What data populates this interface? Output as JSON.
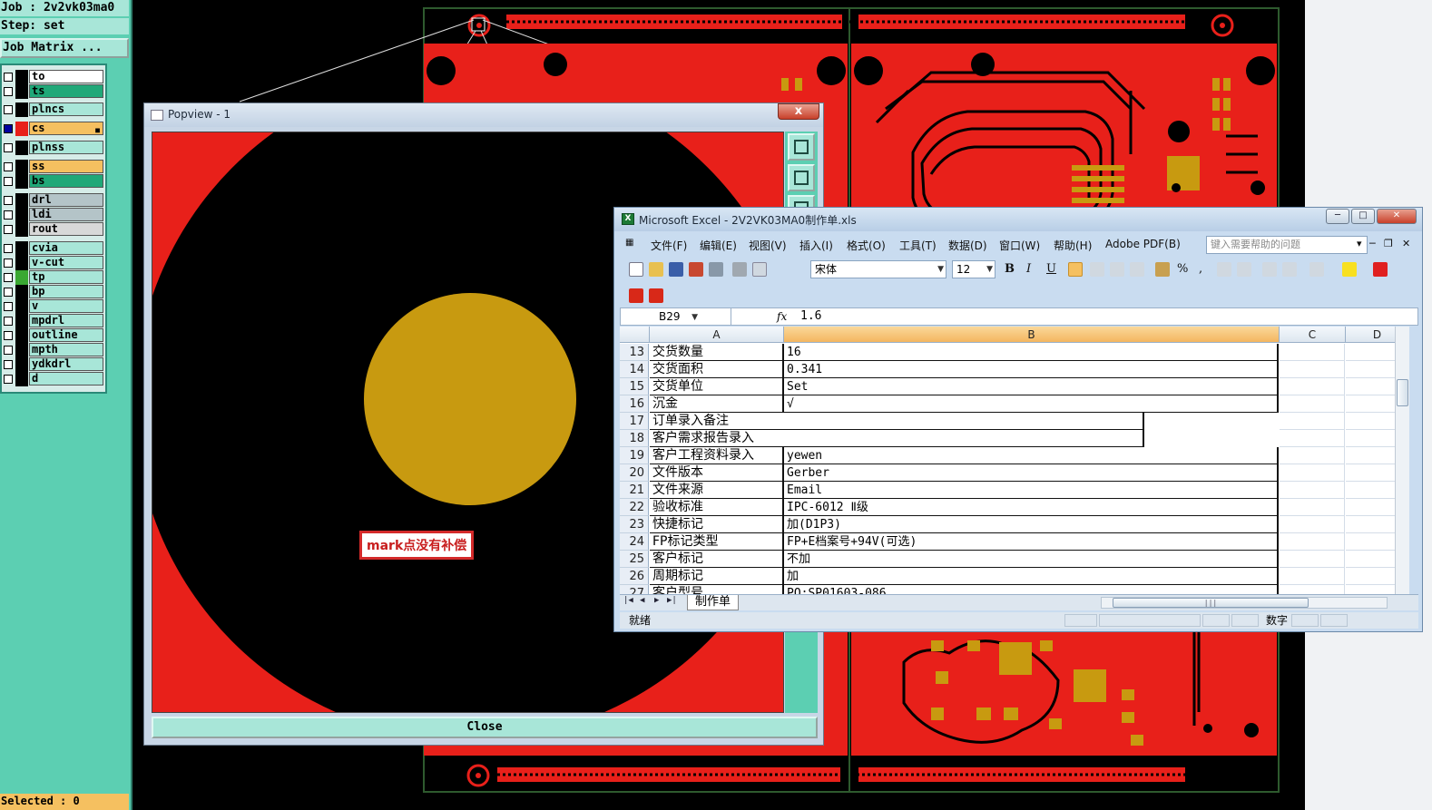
{
  "genesis": {
    "job_line": "Job : 2v2vk03ma0",
    "step_line": "Step: set",
    "job_matrix_button": "Job Matrix ...",
    "selected_status": "Selected : 0",
    "layers": [
      {
        "name": "to",
        "color": "#ffffff",
        "swatch": "#000000",
        "checked": false
      },
      {
        "name": "ts",
        "color": "#20a878",
        "swatch": "#000000",
        "checked": false
      },
      {
        "name": "plncs",
        "color": "#a8e6d8",
        "swatch": "#000000",
        "checked": false
      },
      {
        "name": "cs",
        "color": "#f5c060",
        "swatch": "#e8201a",
        "checked": true
      },
      {
        "name": "plnss",
        "color": "#a8e6d8",
        "swatch": "#000000",
        "checked": false
      },
      {
        "name": "ss",
        "color": "#f5c060",
        "swatch": "#000000",
        "checked": false
      },
      {
        "name": "bs",
        "color": "#20a878",
        "swatch": "#000000",
        "checked": false
      },
      {
        "name": "drl",
        "color": "#b4c4c8",
        "swatch": "#000000",
        "checked": false
      },
      {
        "name": "ldi",
        "color": "#b4c4c8",
        "swatch": "#000000",
        "checked": false
      },
      {
        "name": "rout",
        "color": "#d8d8d8",
        "swatch": "#000000",
        "checked": false
      },
      {
        "name": "cvia",
        "color": "#a8e6d8",
        "swatch": "#000000",
        "checked": false
      },
      {
        "name": "v-cut",
        "color": "#a8e6d8",
        "swatch": "#000000",
        "checked": false
      },
      {
        "name": "tp",
        "color": "#a8e6d8",
        "swatch": "#3aa832",
        "checked": false
      },
      {
        "name": "bp",
        "color": "#a8e6d8",
        "swatch": "#000000",
        "checked": false
      },
      {
        "name": "v",
        "color": "#a8e6d8",
        "swatch": "#000000",
        "checked": false
      },
      {
        "name": "mpdrl",
        "color": "#a8e6d8",
        "swatch": "#000000",
        "checked": false
      },
      {
        "name": "outline",
        "color": "#a8e6d8",
        "swatch": "#000000",
        "checked": false
      },
      {
        "name": "mpth",
        "color": "#a8e6d8",
        "swatch": "#000000",
        "checked": false
      },
      {
        "name": "ydkdrl",
        "color": "#a8e6d8",
        "swatch": "#000000",
        "checked": false
      },
      {
        "name": "d",
        "color": "#a8e6d8",
        "swatch": "#000000",
        "checked": false
      }
    ]
  },
  "popview": {
    "title": "Popview - 1",
    "close_x": "x",
    "close_button": "Close",
    "annotation": "mark点没有补偿",
    "pad_color": "#c89a10",
    "copper_color": "#e8201a"
  },
  "excel": {
    "title": "Microsoft Excel - 2V2VK03MA0制作单.xls",
    "menus": [
      "文件(F)",
      "编辑(E)",
      "视图(V)",
      "插入(I)",
      "格式(O)",
      "工具(T)",
      "数据(D)",
      "窗口(W)",
      "帮助(H)",
      "Adobe PDF(B)"
    ],
    "help_placeholder": "键入需要帮助的问题",
    "font_name": "宋体",
    "font_size": "12",
    "bold": "B",
    "italic": "I",
    "underline": "U",
    "percent": "%",
    "comma": ",",
    "name_box": "B29",
    "fx": "fx",
    "formula_value": "1.6",
    "columns": [
      "A",
      "B",
      "C",
      "D"
    ],
    "rows": [
      {
        "num": "13",
        "a": "交货数量",
        "b": "16"
      },
      {
        "num": "14",
        "a": "交货面积",
        "b": "0.341"
      },
      {
        "num": "15",
        "a": "交货单位",
        "b": "Set"
      },
      {
        "num": "16",
        "a": "沉金",
        "b": "√"
      },
      {
        "num": "17",
        "a": "订单录入备注",
        "b": ""
      },
      {
        "num": "18",
        "a": "客户需求报告录入",
        "b": ""
      },
      {
        "num": "19",
        "a": "客户工程资料录入",
        "b": "yewen"
      },
      {
        "num": "20",
        "a": "文件版本",
        "b": "Gerber"
      },
      {
        "num": "21",
        "a": "文件来源",
        "b": "Email"
      },
      {
        "num": "22",
        "a": "验收标准",
        "b": "IPC-6012 Ⅱ级"
      },
      {
        "num": "23",
        "a": "快捷标记",
        "b": "加(D1P3)"
      },
      {
        "num": "24",
        "a": "FP标记类型",
        "b": "FP+E档案号+94V(可选)"
      },
      {
        "num": "25",
        "a": "客户标记",
        "b": "不加"
      },
      {
        "num": "26",
        "a": "周期标记",
        "b": "加"
      },
      {
        "num": "27",
        "a": "客户型号",
        "b": "PO:SP01603-086"
      }
    ],
    "sheet_tab": "制作单",
    "status_left": "就绪",
    "status_num": "数字"
  }
}
